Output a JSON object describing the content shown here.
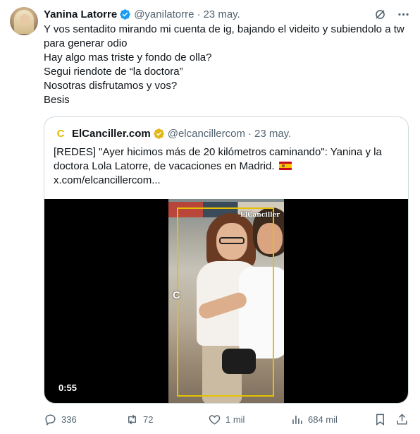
{
  "tweet": {
    "author_name": "Yanina Latorre",
    "author_handle": "@yanilatorre",
    "separator": "·",
    "time": "23 may.",
    "lines": [
      "Y vos sentadito mirando mi cuenta de ig, bajando el videito y subiendolo a tw para generar odio",
      "Hay algo mas triste y fondo de olla?",
      "Segui riendote de “la doctora”",
      "Nosotras disfrutamos y vos?",
      "Besis"
    ]
  },
  "quote": {
    "logo_letter": "C",
    "author_name": "ElCanciller.com",
    "author_handle": "@elcancillercom",
    "separator": "·",
    "time": "23 may.",
    "text": "[REDES] \"Ayer hicimos más de 20 kilómetros caminando\": Yanina y la doctora Lola Latorre, de vacaciones en Madrid.",
    "link": "x.com/elcancillercom...",
    "video": {
      "duration": "0:55",
      "watermark": "ElCanciller",
      "corner_mark": "C"
    }
  },
  "actions": {
    "replies": "336",
    "reposts": "72",
    "likes": "1 mil",
    "views": "684 mil"
  },
  "colors": {
    "verified_blue": "#1d9bf0",
    "verified_gold": "#e2b719",
    "muted_text": "#536471",
    "video_frame": "#e6c100"
  },
  "icons": [
    "verified-icon",
    "grok-icon",
    "more-icon",
    "gold-verified-icon",
    "spain-flag-icon",
    "reply-icon",
    "repost-icon",
    "like-icon",
    "views-icon",
    "bookmark-icon",
    "share-icon"
  ]
}
